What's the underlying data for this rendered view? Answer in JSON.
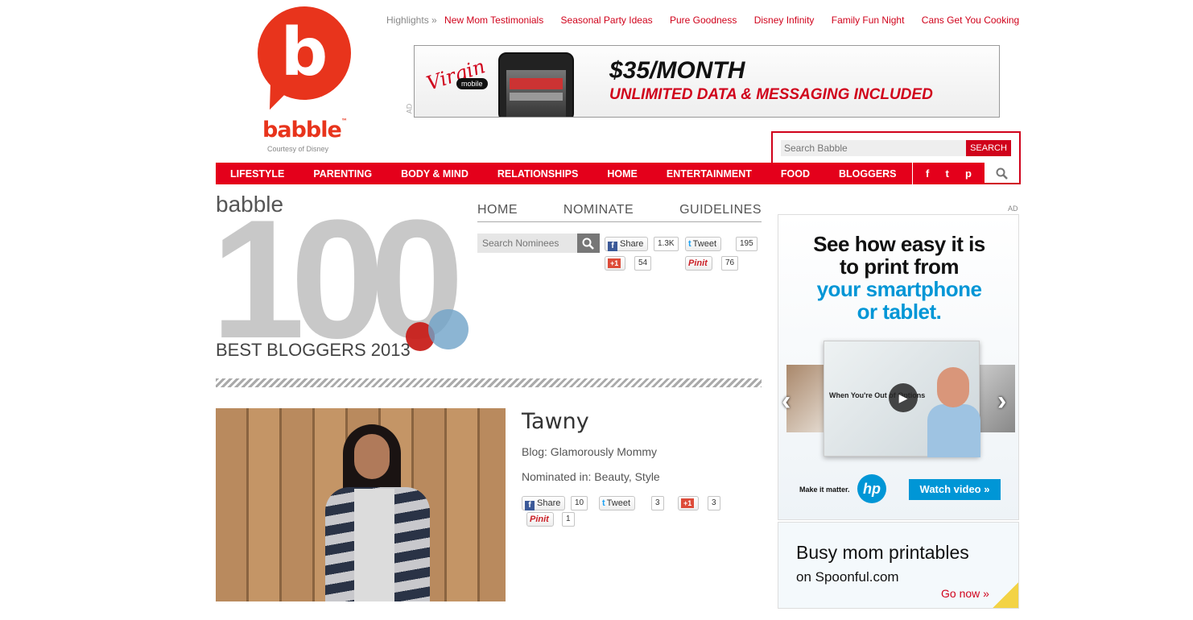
{
  "logo": {
    "letter": "b",
    "word": "babble",
    "tm": "™",
    "courtesy": "Courtesy of Disney"
  },
  "highlights": {
    "label": "Highlights »",
    "links": [
      "New Mom Testimonials",
      "Seasonal Party Ideas",
      "Pure Goodness",
      "Disney Infinity",
      "Family Fun Night",
      "Cans Get You Cooking"
    ]
  },
  "top_ad": {
    "tag": "AD",
    "brand": "Virgin",
    "brand_sub": "mobile",
    "price": "$35/MONTH",
    "tagline": "UNLIMITED DATA & MESSAGING INCLUDED"
  },
  "search": {
    "placeholder": "Search Babble",
    "button": "SEARCH"
  },
  "nav": {
    "items": [
      "LIFESTYLE",
      "PARENTING",
      "BODY & MIND",
      "RELATIONSHIPS",
      "HOME",
      "ENTERTAINMENT",
      "FOOD",
      "BLOGGERS"
    ],
    "social": [
      "f",
      "t",
      "p"
    ]
  },
  "b100": {
    "babble": "babble",
    "number": "100",
    "subtitle": "BEST BLOGGERS 2013"
  },
  "subnav": [
    "HOME",
    "NOMINATE",
    "GUIDELINES"
  ],
  "nominee_search": {
    "placeholder": "Search Nominees"
  },
  "page_share": {
    "fb_label": "Share",
    "fb_count": "1.3K",
    "tw_label": "Tweet",
    "tw_count": "195",
    "gp_label": "+1",
    "gp_count": "54",
    "pin_label": "Pinit",
    "pin_count": "76"
  },
  "nominee": {
    "name": "Tawny",
    "blog": "Blog: Glamorously Mommy",
    "nominated": "Nominated in: Beauty, Style",
    "fb_label": "Share",
    "fb_count": "10",
    "tw_label": "Tweet",
    "tw_count": "3",
    "gp_label": "+1",
    "gp_count": "3",
    "pin_label": "Pinit",
    "pin_count": "1"
  },
  "right_ad": {
    "label": "AD",
    "line1": "See how easy it is",
    "line2": "to print from",
    "line3": "your smartphone",
    "line4": "or tablet.",
    "video_title": "When You're Out of Options",
    "make_it": "Make it matter.",
    "hp": "hp",
    "watch": "Watch video »"
  },
  "right_ad2": {
    "title": "Busy mom printables",
    "sub": "on Spoonful.com",
    "go": "Go now »"
  },
  "colors": {
    "brand_red": "#e4001b",
    "link_red": "#d0021b",
    "hp_blue": "#0096d6"
  }
}
